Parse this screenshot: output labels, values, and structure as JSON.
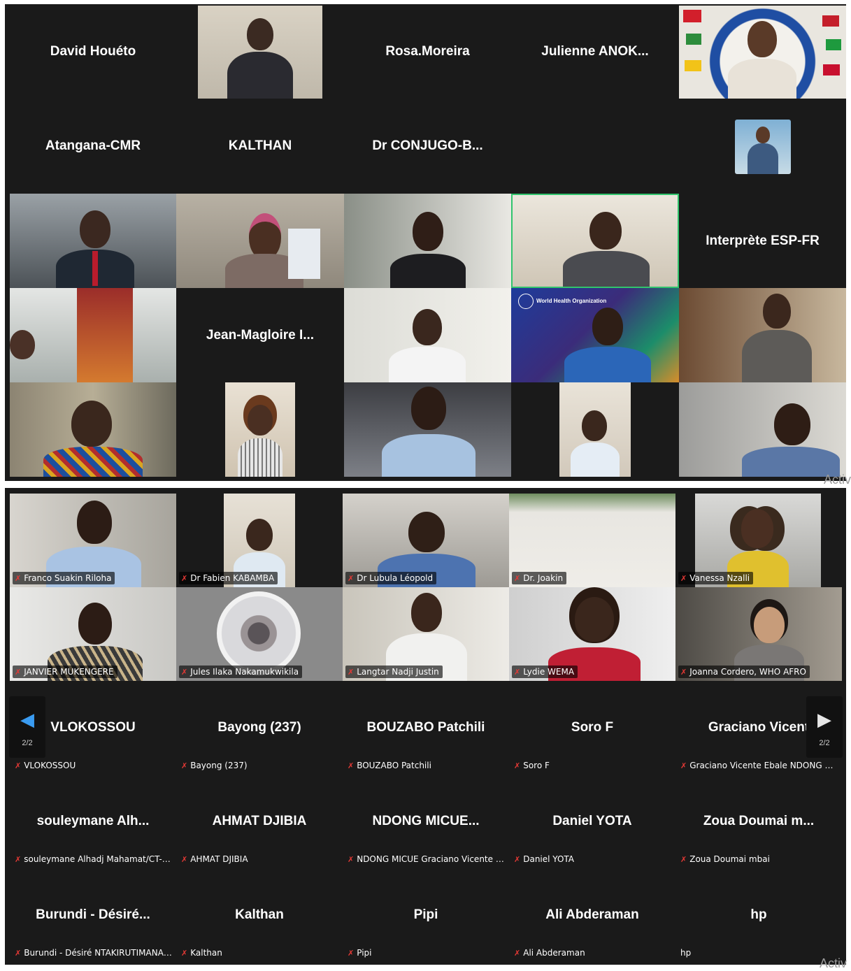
{
  "top_panel": {
    "name_tiles": [
      {
        "name": "David Houéto"
      },
      {
        "name": "Rosa.Moreira"
      },
      {
        "name": "Julienne  ANOK..."
      },
      {
        "name": "Atangana-CMR"
      },
      {
        "name": "KALTHAN"
      },
      {
        "name": "Dr  CONJUGO-B..."
      },
      {
        "name": "Interprète ESP-FR"
      },
      {
        "name": "Jean-Magloire  I..."
      }
    ],
    "who_logo_text": "World Health Organization"
  },
  "bottom_panel": {
    "video_tiles": [
      {
        "label": "Franco Suakin Riloha"
      },
      {
        "label": "Dr Fabien KABAMBA"
      },
      {
        "label": "Dr Lubula Léopold"
      },
      {
        "label": "Dr. Joakin"
      },
      {
        "label": "Vanessa Nzalli"
      },
      {
        "label": "JANVIER MUKENGERE"
      },
      {
        "label": "Jules Ilaka Nakamukwikila"
      },
      {
        "label": "Langtar Nadji Justin"
      },
      {
        "label": "Lydie WEMA"
      },
      {
        "label": "Joanna Cordero, WHO AFRO"
      }
    ],
    "name_tiles": [
      {
        "name": "VLOKOSSOU",
        "label": "VLOKOSSOU"
      },
      {
        "name": "Bayong (237)",
        "label": "Bayong (237)"
      },
      {
        "name": "BOUZABO Patchili",
        "label": "BOUZABO Patchili"
      },
      {
        "name": "Soro F",
        "label": "Soro F"
      },
      {
        "name": "Graciano  Vicent",
        "label": "Graciano Vicente Ebale NDONG MIC..."
      },
      {
        "name": "souleymane  Alh...",
        "label": "souleymane Alhadj Mahamat/CT-CR..."
      },
      {
        "name": "AHMAT DJIBIA",
        "label": "AHMAT DJIBIA"
      },
      {
        "name": "NDONG  MICUE...",
        "label": "NDONG MICUE Graciano Vicente Eba..."
      },
      {
        "name": "Daniel YOTA",
        "label": "Daniel YOTA"
      },
      {
        "name": "Zoua  Doumai  m...",
        "label": "Zoua Doumai mbai"
      },
      {
        "name": "Burundi  -  Désiré...",
        "label": "Burundi - Désiré NTAKIRUTIMANA, D..."
      },
      {
        "name": "Kalthan",
        "label": "Kalthan"
      },
      {
        "name": "Pipi",
        "label": "Pipi"
      },
      {
        "name": "Ali Abderaman",
        "label": "Ali Abderaman"
      },
      {
        "name": "hp",
        "label": "hp"
      }
    ],
    "nav": {
      "prev_page": "2/2",
      "next_page": "2/2"
    }
  },
  "watermark": "Activ",
  "colors": {
    "background": "#1a1a1a",
    "active_speaker_border": "#31c46d",
    "muted_mic": "#e53935"
  },
  "icons": {
    "muted": "microphone-muted-icon",
    "prev": "chevron-left-icon",
    "next": "chevron-right-icon"
  }
}
